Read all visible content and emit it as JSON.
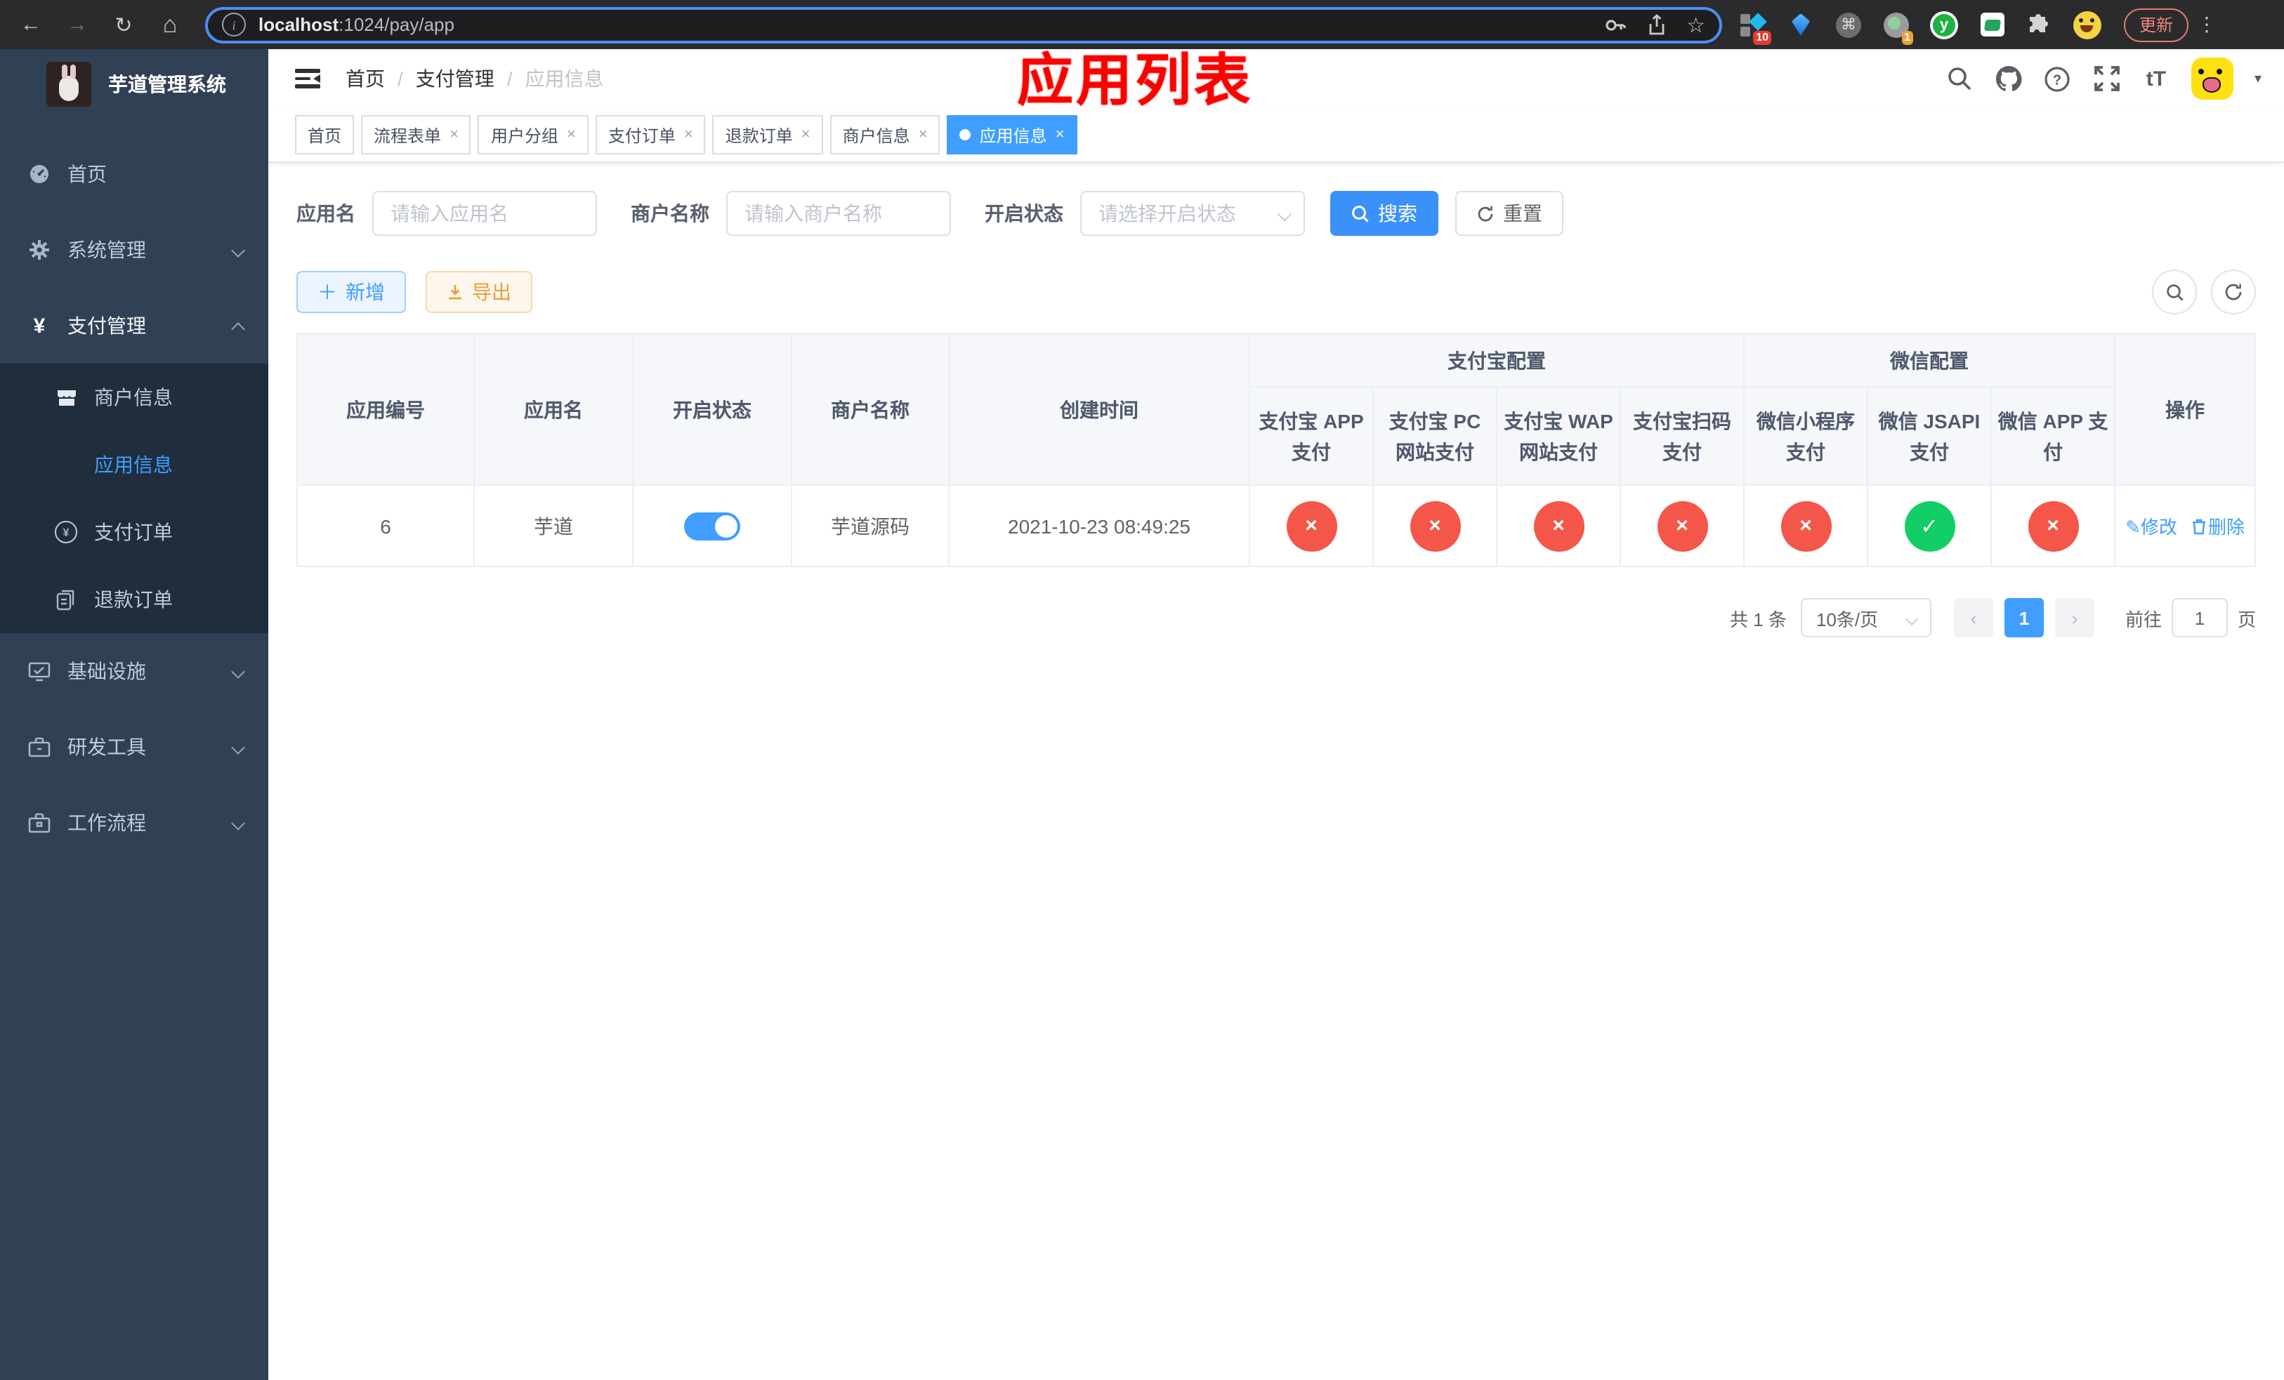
{
  "browser": {
    "url": {
      "host": "localhost",
      "path": ":1024/pay/app"
    },
    "update_label": "更新",
    "ext_badge_10": "10",
    "ext_badge_1": "1",
    "y_letter": "y"
  },
  "sidebar": {
    "title": "芋道管理系统",
    "items": [
      {
        "label": "首页"
      },
      {
        "label": "系统管理"
      },
      {
        "label": "支付管理"
      },
      {
        "label": "商户信息"
      },
      {
        "label": "应用信息"
      },
      {
        "label": "支付订单"
      },
      {
        "label": "退款订单"
      },
      {
        "label": "基础设施"
      },
      {
        "label": "研发工具"
      },
      {
        "label": "工作流程"
      }
    ]
  },
  "navbar": {
    "breadcrumb": [
      "首页",
      "支付管理",
      "应用信息"
    ],
    "font_icon": "tT"
  },
  "annotation": "应用列表",
  "tabs": [
    {
      "label": "首页",
      "closable": false
    },
    {
      "label": "流程表单",
      "closable": true
    },
    {
      "label": "用户分组",
      "closable": true
    },
    {
      "label": "支付订单",
      "closable": true
    },
    {
      "label": "退款订单",
      "closable": true
    },
    {
      "label": "商户信息",
      "closable": true
    },
    {
      "label": "应用信息",
      "closable": true,
      "active": true
    }
  ],
  "filters": {
    "app_name_label": "应用名",
    "app_name_placeholder": "请输入应用名",
    "merchant_label": "商户名称",
    "merchant_placeholder": "请输入商户名称",
    "status_label": "开启状态",
    "status_placeholder": "请选择开启状态",
    "search_label": "搜索",
    "reset_label": "重置"
  },
  "toolbar": {
    "add_label": "新增",
    "export_label": "导出"
  },
  "table": {
    "group_headers": [
      "支付宝配置",
      "微信配置"
    ],
    "columns": [
      "应用编号",
      "应用名",
      "开启状态",
      "商户名称",
      "创建时间",
      "支付宝 APP 支付",
      "支付宝 PC 网站支付",
      "支付宝 WAP 网站支付",
      "支付宝扫码支付",
      "微信小程序支付",
      "微信 JSAPI 支付",
      "微信 APP 支付",
      "操作"
    ],
    "row": {
      "id": "6",
      "name": "芋道",
      "enabled": true,
      "merchant": "芋道源码",
      "created_at": "2021-10-23 08:49:25",
      "pay_enabled": [
        false,
        false,
        false,
        false,
        false,
        true,
        false
      ],
      "edit_label": "修改",
      "delete_label": "删除"
    }
  },
  "pagination": {
    "total": "共 1 条",
    "page_size": "10条/页",
    "current": "1",
    "goto_label": "前往",
    "goto_value": "1",
    "unit_label": "页"
  },
  "colors": {
    "accent": "#409eff",
    "danger": "#f4564a",
    "success": "#13ce66",
    "warning": "#e6a23c",
    "sidebar": "#304156",
    "submenu": "#1f2d3d",
    "annotation": "#f80400"
  }
}
